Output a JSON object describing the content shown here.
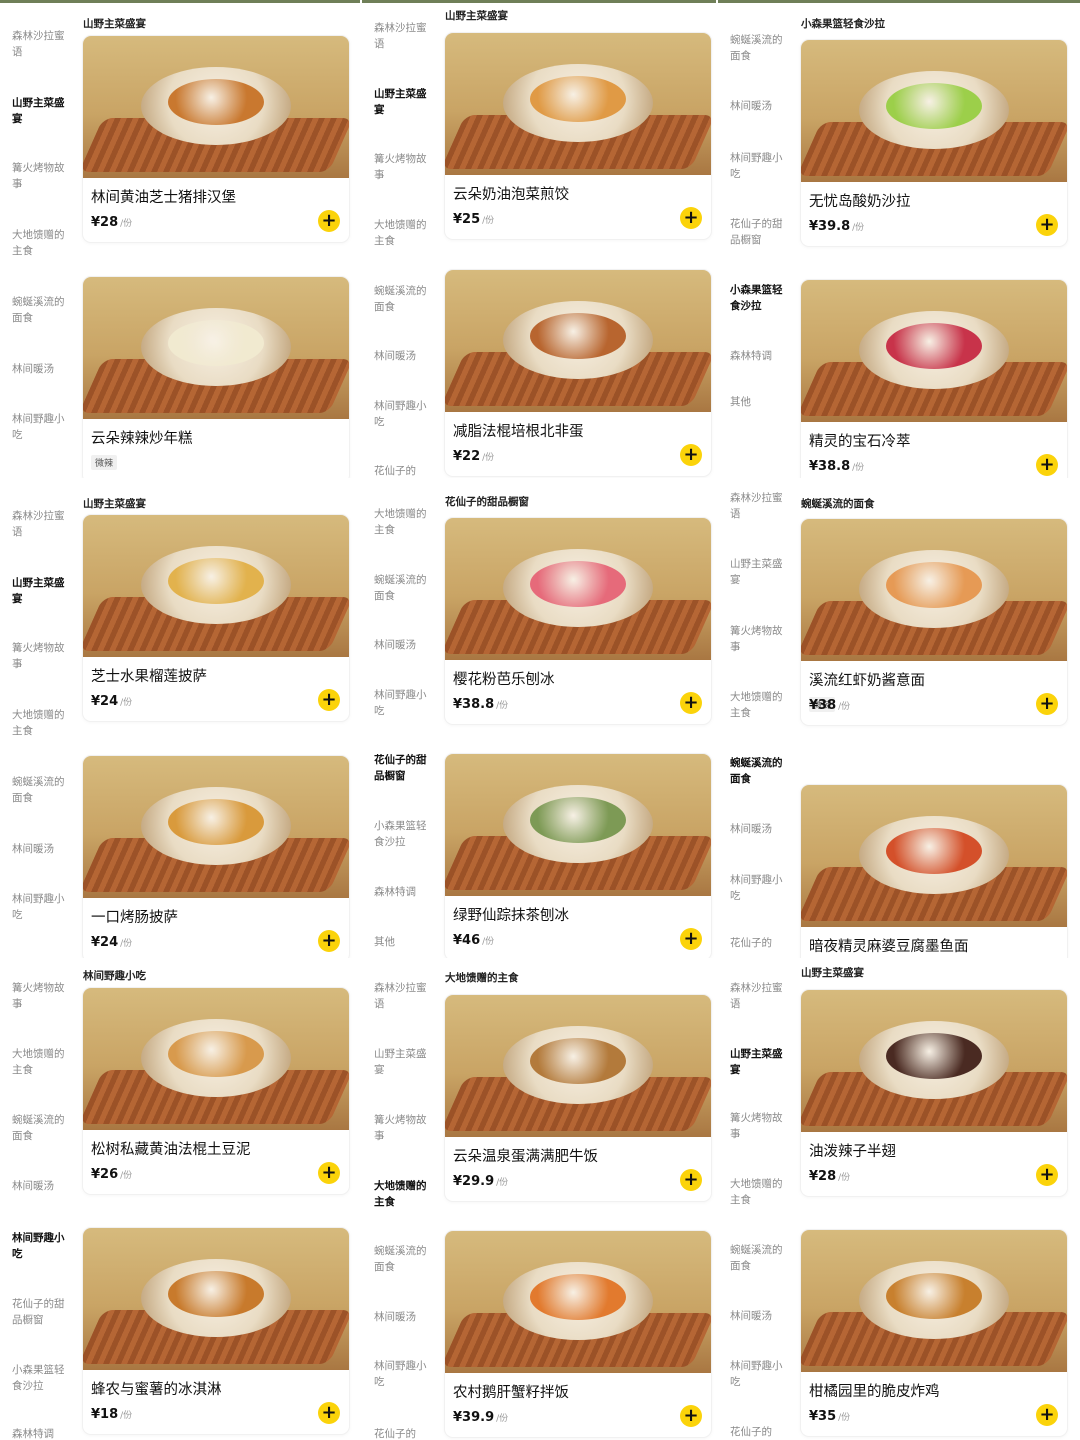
{
  "unit": "/份",
  "plus_icon": "plus-icon",
  "panels": [
    {
      "sidebar": [
        {
          "label": "森林沙拉蜜语",
          "active": false
        },
        {
          "label": "山野主菜盛宴",
          "active": true
        },
        {
          "label": "篝火烤物故事",
          "active": false
        },
        {
          "label": "大地馈赠的主食",
          "active": false
        },
        {
          "label": "蜿蜒溪流的面食",
          "active": false
        },
        {
          "label": "林间暖汤",
          "active": false
        },
        {
          "label": "林间野趣小吃",
          "active": false
        }
      ],
      "headers": [
        "山野主菜盛宴"
      ],
      "cards": [
        {
          "name": "林间黄油芝士猪排汉堡",
          "price": "¥28",
          "tag": "",
          "food_color": "#c9782f"
        },
        {
          "name": "云朵辣辣炒年糕",
          "price": "",
          "tag": "微辣",
          "food_color": "#f1ead0"
        }
      ]
    },
    {
      "sidebar": [
        {
          "label": "森林沙拉蜜语",
          "active": false
        },
        {
          "label": "山野主菜盛宴",
          "active": true
        },
        {
          "label": "篝火烤物故事",
          "active": false
        },
        {
          "label": "大地馈赠的主食",
          "active": false
        },
        {
          "label": "蜿蜒溪流的面食",
          "active": false
        },
        {
          "label": "林间暖汤",
          "active": false
        },
        {
          "label": "林间野趣小吃",
          "active": false
        },
        {
          "label": "花仙子的",
          "active": false
        }
      ],
      "headers": [
        "山野主菜盛宴"
      ],
      "cards": [
        {
          "name": "云朵奶油泡菜煎饺",
          "price": "¥25",
          "tag": "",
          "food_color": "#e09a45"
        },
        {
          "name": "减脂法棍培根北非蛋",
          "price": "¥22",
          "tag": "",
          "food_color": "#b8652f"
        }
      ]
    },
    {
      "sidebar": [
        {
          "label": "蜿蜒溪流的面食",
          "active": false
        },
        {
          "label": "林间暖汤",
          "active": false
        },
        {
          "label": "林间野趣小吃",
          "active": false
        },
        {
          "label": "花仙子的甜品橱窗",
          "active": false
        },
        {
          "label": "小森果篮轻食沙拉",
          "active": true
        },
        {
          "label": "森林特调",
          "active": false
        },
        {
          "label": "其他",
          "active": false
        }
      ],
      "headers": [
        "小森果篮轻食沙拉"
      ],
      "cards": [
        {
          "name": "无忧岛酸奶沙拉",
          "price": "¥39.8",
          "tag": "",
          "food_color": "#9ccf4a"
        },
        {
          "name": "精灵的宝石冷萃",
          "price": "¥38.8",
          "tag": "",
          "food_color": "#c8334a"
        }
      ]
    },
    {
      "sidebar": [
        {
          "label": "森林沙拉蜜语",
          "active": false
        },
        {
          "label": "山野主菜盛宴",
          "active": true
        },
        {
          "label": "篝火烤物故事",
          "active": false
        },
        {
          "label": "大地馈赠的主食",
          "active": false
        },
        {
          "label": "蜿蜒溪流的面食",
          "active": false
        },
        {
          "label": "林间暖汤",
          "active": false
        },
        {
          "label": "林间野趣小吃",
          "active": false
        }
      ],
      "headers": [
        "山野主菜盛宴"
      ],
      "cards": [
        {
          "name": "芝士水果榴莲披萨",
          "price": "¥24",
          "tag": "",
          "food_color": "#e2b24d"
        },
        {
          "name": "一口烤肠披萨",
          "price": "¥24",
          "tag": "",
          "food_color": "#d99a3c"
        }
      ]
    },
    {
      "sidebar": [
        {
          "label": "大地馈赠的主食",
          "active": false
        },
        {
          "label": "蜿蜒溪流的面食",
          "active": false
        },
        {
          "label": "林间暖汤",
          "active": false
        },
        {
          "label": "林间野趣小吃",
          "active": false
        },
        {
          "label": "花仙子的甜品橱窗",
          "active": true
        },
        {
          "label": "小森果篮轻食沙拉",
          "active": false
        },
        {
          "label": "森林特调",
          "active": false
        },
        {
          "label": "其他",
          "active": false
        }
      ],
      "headers": [
        "花仙子的甜品橱窗"
      ],
      "cards": [
        {
          "name": "樱花粉芭乐刨冰",
          "price": "¥38.8",
          "tag": "",
          "food_color": "#e66a7a"
        },
        {
          "name": "绿野仙踪抹茶刨冰",
          "price": "¥46",
          "tag": "",
          "food_color": "#7d9a55"
        }
      ]
    },
    {
      "sidebar": [
        {
          "label": "森林沙拉蜜语",
          "active": false
        },
        {
          "label": "山野主菜盛宴",
          "active": false
        },
        {
          "label": "篝火烤物故事",
          "active": false
        },
        {
          "label": "大地馈赠的主食",
          "active": false
        },
        {
          "label": "蜿蜒溪流的面食",
          "active": true
        },
        {
          "label": "林间暖汤",
          "active": false
        },
        {
          "label": "林间野趣小吃",
          "active": false
        },
        {
          "label": "花仙子的",
          "active": false
        }
      ],
      "headers": [
        "蜿蜒溪流的面食"
      ],
      "cards": [
        {
          "name": "溪流红虾奶酱意面",
          "price": "¥38",
          "tag": "微辣",
          "food_color": "#e69a55"
        },
        {
          "name": "暗夜精灵麻婆豆腐墨鱼面",
          "price": "",
          "tag": "",
          "food_color": "#d4502a"
        }
      ]
    },
    {
      "sidebar": [
        {
          "label": "篝火烤物故事",
          "active": false
        },
        {
          "label": "大地馈赠的主食",
          "active": false
        },
        {
          "label": "蜿蜒溪流的面食",
          "active": false
        },
        {
          "label": "林间暖汤",
          "active": false
        },
        {
          "label": "林间野趣小吃",
          "active": true
        },
        {
          "label": "花仙子的甜品橱窗",
          "active": false
        },
        {
          "label": "小森果篮轻食沙拉",
          "active": false
        },
        {
          "label": "森林特调",
          "active": false
        }
      ],
      "headers": [
        "林间野趣小吃"
      ],
      "cards": [
        {
          "name": "松树私藏黄油法棍土豆泥",
          "price": "¥26",
          "tag": "",
          "food_color": "#d89a4d"
        },
        {
          "name": "蜂农与蜜薯的冰淇淋",
          "price": "¥18",
          "tag": "",
          "food_color": "#c87a2c"
        }
      ]
    },
    {
      "sidebar": [
        {
          "label": "森林沙拉蜜语",
          "active": false
        },
        {
          "label": "山野主菜盛宴",
          "active": false
        },
        {
          "label": "篝火烤物故事",
          "active": false
        },
        {
          "label": "大地馈赠的主食",
          "active": true
        },
        {
          "label": "蜿蜒溪流的面食",
          "active": false
        },
        {
          "label": "林间暖汤",
          "active": false
        },
        {
          "label": "林间野趣小吃",
          "active": false
        },
        {
          "label": "花仙子的",
          "active": false
        }
      ],
      "headers": [
        "大地馈赠的主食"
      ],
      "cards": [
        {
          "name": "云朵温泉蛋满满肥牛饭",
          "price": "¥29.9",
          "tag": "",
          "food_color": "#b37a3b"
        },
        {
          "name": "农村鹅肝蟹籽拌饭",
          "price": "¥39.9",
          "tag": "",
          "food_color": "#e27a2e"
        }
      ]
    },
    {
      "sidebar": [
        {
          "label": "森林沙拉蜜语",
          "active": false
        },
        {
          "label": "山野主菜盛宴",
          "active": true
        },
        {
          "label": "篝火烤物故事",
          "active": false
        },
        {
          "label": "大地馈赠的主食",
          "active": false
        },
        {
          "label": "蜿蜒溪流的面食",
          "active": false
        },
        {
          "label": "林间暖汤",
          "active": false
        },
        {
          "label": "林间野趣小吃",
          "active": false
        },
        {
          "label": "花仙子的",
          "active": false
        }
      ],
      "headers": [
        "山野主菜盛宴"
      ],
      "cards": [
        {
          "name": "油泼辣子半翅",
          "price": "¥28",
          "tag": "",
          "food_color": "#4a2a22"
        },
        {
          "name": "柑橘园里的脆皮炸鸡",
          "price": "¥35",
          "tag": "",
          "food_color": "#c8802e"
        }
      ]
    }
  ]
}
